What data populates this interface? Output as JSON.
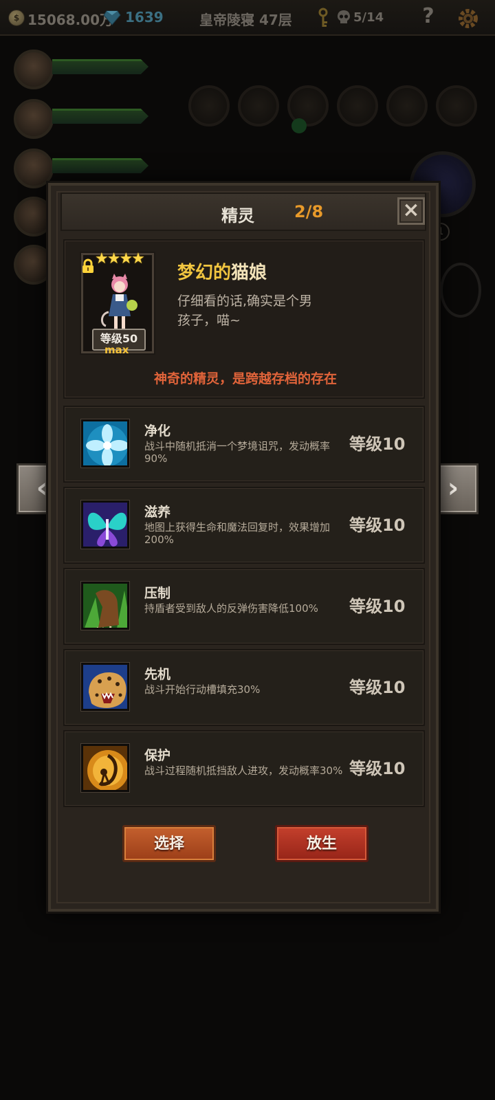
{
  "topbar": {
    "gold": "15068.00万",
    "gems": "1639",
    "floor_title": "皇帝陵寝 47层",
    "kill_progress": "5/14",
    "help_label": "?"
  },
  "scene": {
    "boss_count": "1"
  },
  "modal": {
    "title": "精灵",
    "count": "2/8",
    "close_label": "×"
  },
  "pet": {
    "stars": 4,
    "stars_text": "★★★★",
    "locked": true,
    "level_label": "等级50",
    "max_label": "max",
    "name_highlight": "梦幻的",
    "name_rest": "猫娘",
    "description_line1": "仔细看的话,确实是个男",
    "description_line2": "孩子，喵~",
    "tagline": "神奇的精灵，是跨越存档的存在"
  },
  "skills": [
    {
      "name": "净化",
      "desc": "战斗中随机抵消一个梦境诅咒，发动概率90%",
      "level": "等级10",
      "icon": "blue-flower-icon"
    },
    {
      "name": "滋养",
      "desc": "地图上获得生命和魔法回复时，效果增加200%",
      "level": "等级10",
      "icon": "butterfly-wings-icon"
    },
    {
      "name": "压制",
      "desc": "持盾者受到敌人的反弹伤害降低100%",
      "level": "等级10",
      "icon": "claw-icon"
    },
    {
      "name": "先机",
      "desc": "战斗开始行动槽填充30%",
      "level": "等级10",
      "icon": "leopard-icon"
    },
    {
      "name": "保护",
      "desc": "战斗过程随机抵挡敌人进攻，发动概率30%",
      "level": "等级10",
      "icon": "fairy-shield-icon"
    }
  ],
  "buttons": {
    "select_label": "选择",
    "release_label": "放生"
  },
  "nav": {
    "prev_label": "‹",
    "next_label": "›"
  },
  "colors": {
    "accent_orange": "#e89a2a",
    "name_gold": "#f2c640",
    "tagline_red": "#e2643a",
    "select_button": "#b04e22",
    "release_button": "#b0321f"
  }
}
